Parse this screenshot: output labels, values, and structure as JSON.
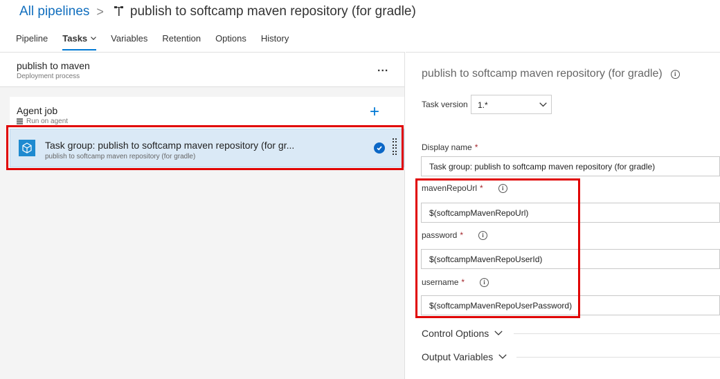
{
  "breadcrumb": {
    "root": "All pipelines",
    "separator": ">",
    "title": "publish to softcamp maven repository (for gradle)"
  },
  "tabs": [
    {
      "label": "Pipeline"
    },
    {
      "label": "Tasks"
    },
    {
      "label": "Variables"
    },
    {
      "label": "Retention"
    },
    {
      "label": "Options"
    },
    {
      "label": "History"
    }
  ],
  "process": {
    "title": "publish to maven",
    "subtitle": "Deployment process",
    "more_label": "..."
  },
  "agent_job": {
    "title": "Agent job",
    "subtitle": "Run on agent",
    "add_label": "+"
  },
  "task": {
    "title": "Task group: publish to softcamp maven repository (for gr...",
    "subtitle": "publish to softcamp maven repository (for gradle)"
  },
  "details": {
    "title": "publish to softcamp maven repository (for gradle)",
    "task_version_label": "Task version",
    "task_version_value": "1.*",
    "display_name_label": "Display name",
    "display_name_value": "Task group: publish to softcamp maven repository (for gradle)",
    "fields": [
      {
        "label": "mavenRepoUrl",
        "value": "$(softcampMavenRepoUrl)"
      },
      {
        "label": "password",
        "value": "$(softcampMavenRepoUserId)"
      },
      {
        "label": "username",
        "value": "$(softcampMavenRepoUserPassword)"
      }
    ],
    "required_marker": "*",
    "info_glyph": "i",
    "sections": [
      {
        "label": "Control Options"
      },
      {
        "label": "Output Variables"
      }
    ]
  },
  "colors": {
    "link": "#106ebe",
    "accent": "#0078d4",
    "selected_row": "#dae9f6",
    "highlight_box": "#e00000",
    "required": "#a4262c"
  }
}
